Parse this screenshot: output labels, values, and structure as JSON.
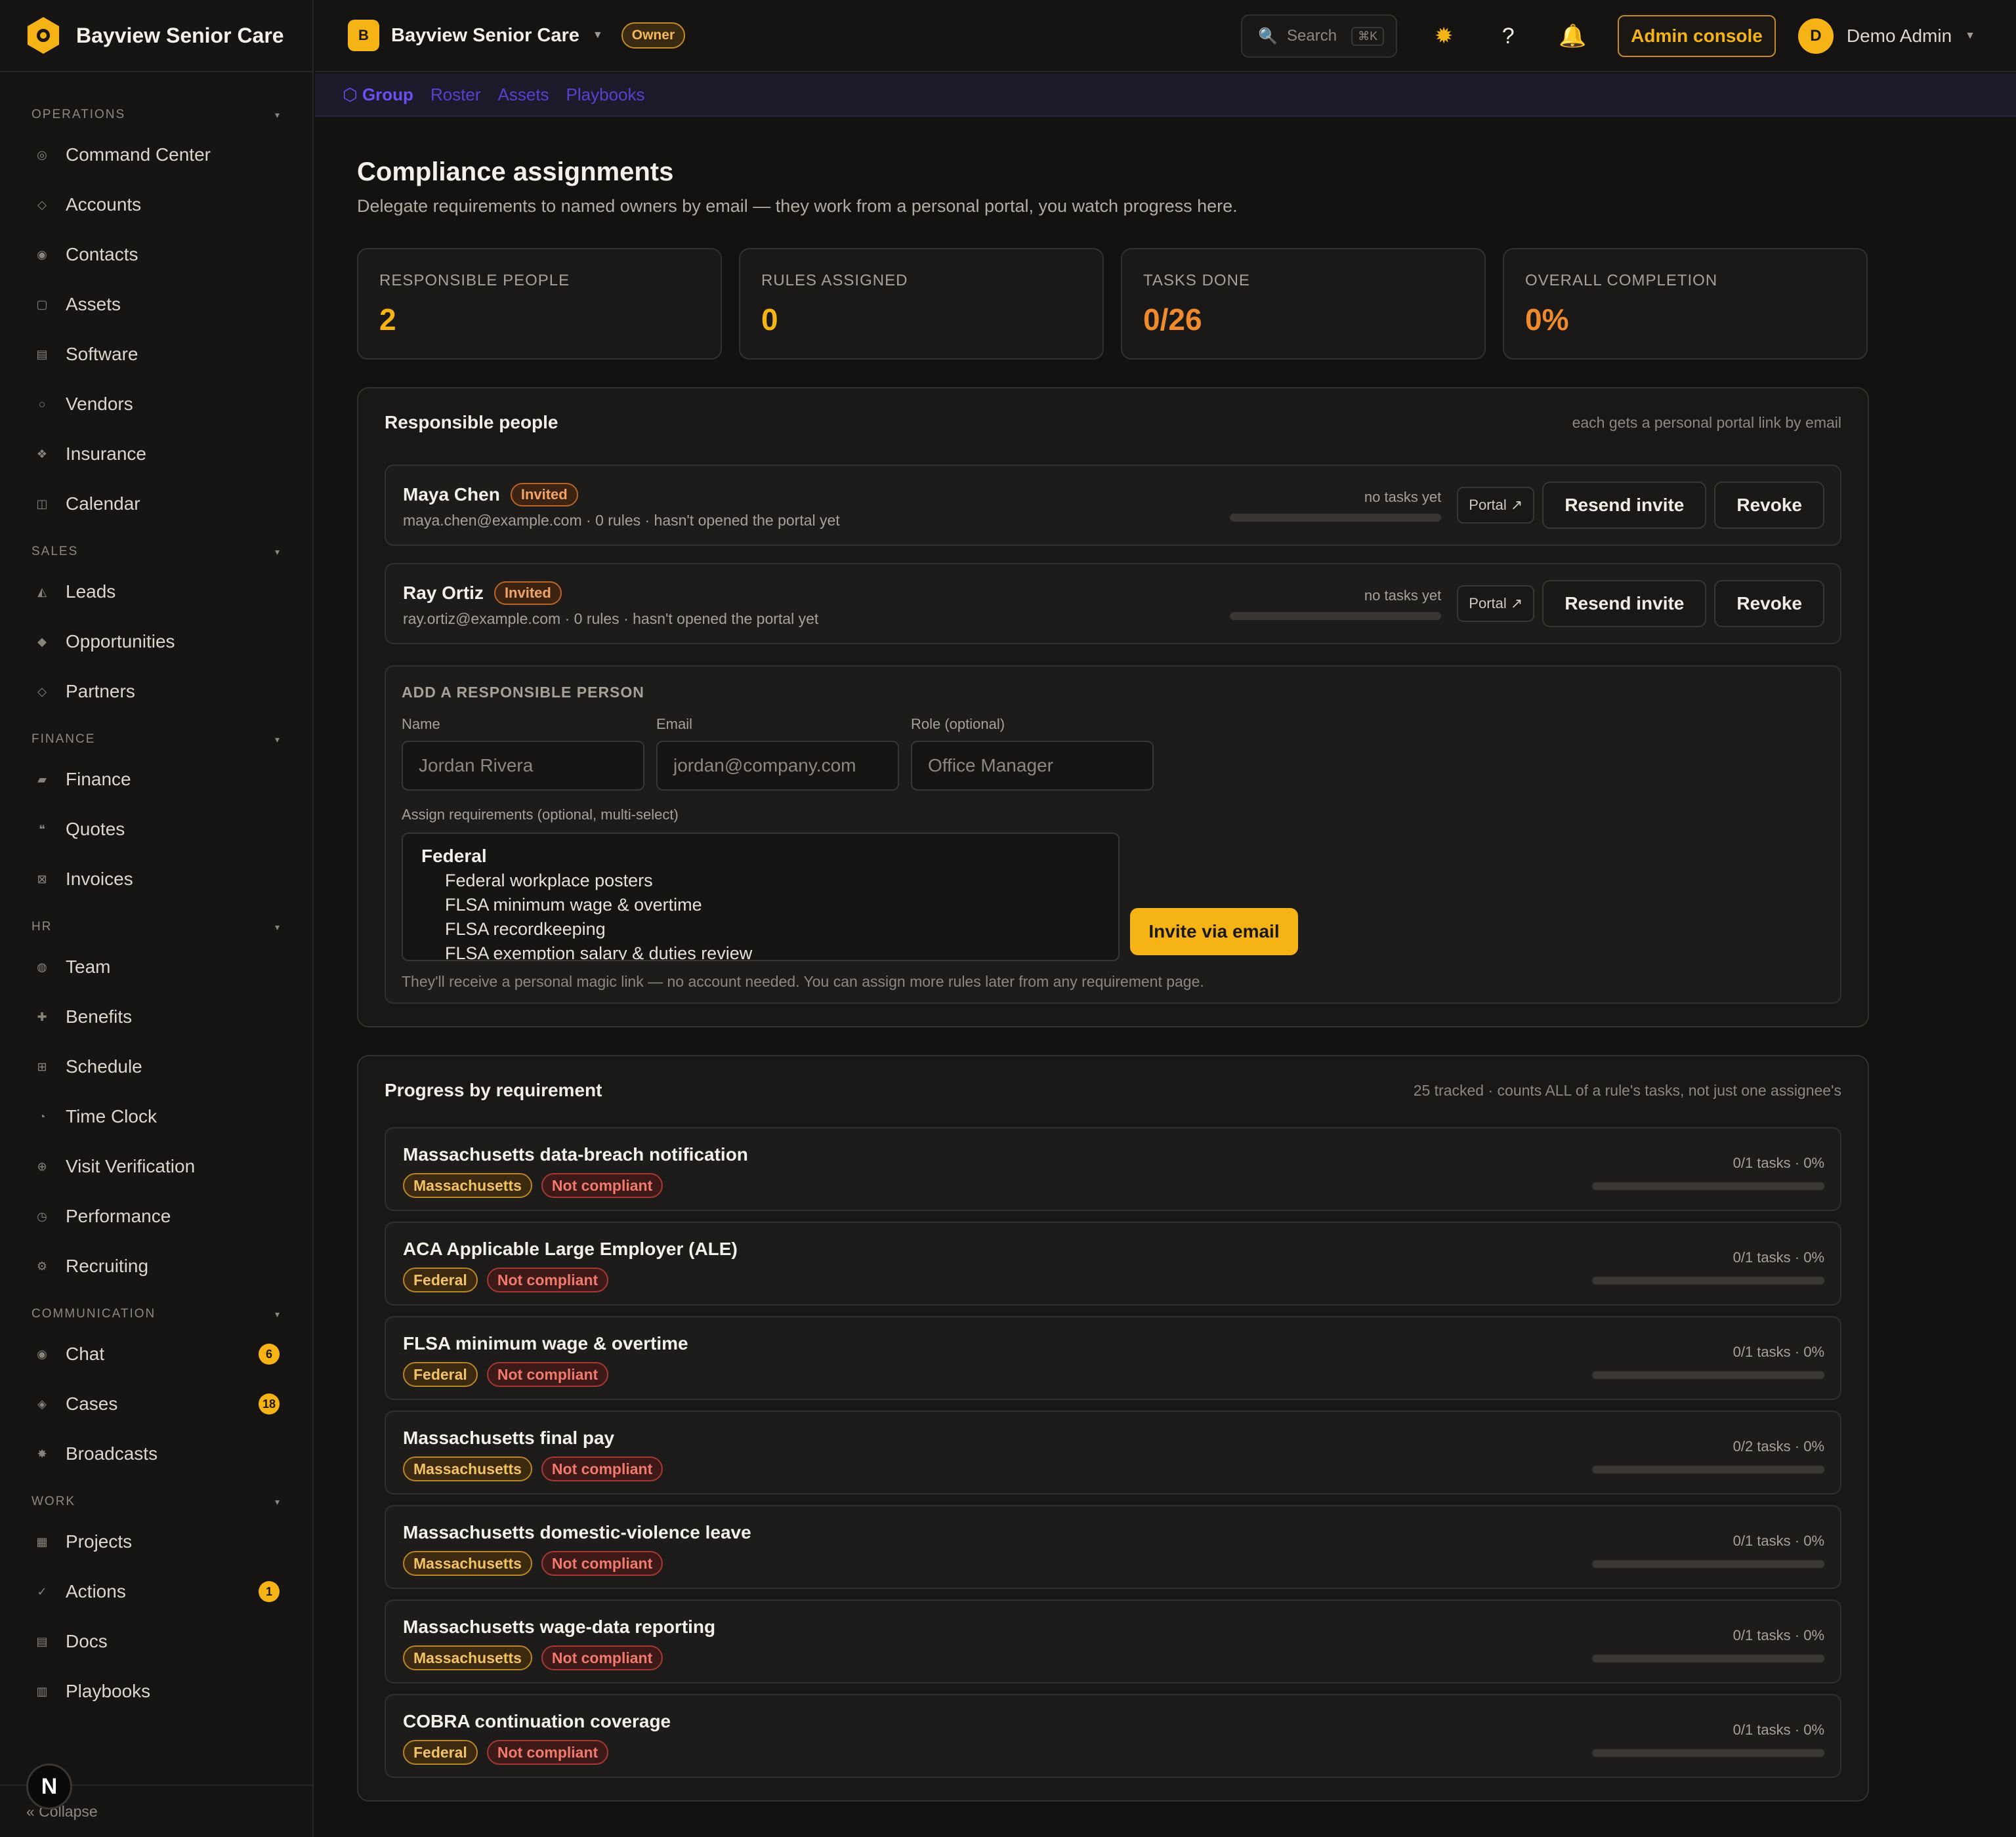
{
  "brand": {
    "name": "Bayview Senior Care"
  },
  "sidebar": {
    "sections": [
      {
        "title": "Operations",
        "items": [
          {
            "label": "Command Center",
            "icon": "◎"
          },
          {
            "label": "Accounts",
            "icon": "◇"
          },
          {
            "label": "Contacts",
            "icon": "◉"
          },
          {
            "label": "Assets",
            "icon": "▢"
          },
          {
            "label": "Software",
            "icon": "▤"
          },
          {
            "label": "Vendors",
            "icon": "○"
          },
          {
            "label": "Insurance",
            "icon": "❖"
          },
          {
            "label": "Calendar",
            "icon": "◫"
          }
        ]
      },
      {
        "title": "Sales",
        "items": [
          {
            "label": "Leads",
            "icon": "◭"
          },
          {
            "label": "Opportunities",
            "icon": "◆"
          },
          {
            "label": "Partners",
            "icon": "◇"
          }
        ]
      },
      {
        "title": "Finance",
        "items": [
          {
            "label": "Finance",
            "icon": "▰"
          },
          {
            "label": "Quotes",
            "icon": "❝"
          },
          {
            "label": "Invoices",
            "icon": "⊠"
          }
        ]
      },
      {
        "title": "HR",
        "items": [
          {
            "label": "Team",
            "icon": "◍"
          },
          {
            "label": "Benefits",
            "icon": "✚"
          },
          {
            "label": "Schedule",
            "icon": "⊞"
          },
          {
            "label": "Time Clock",
            "icon": "◔"
          },
          {
            "label": "Visit Verification",
            "icon": "⊕"
          },
          {
            "label": "Performance",
            "icon": "◷"
          },
          {
            "label": "Recruiting",
            "icon": "⚙"
          }
        ]
      },
      {
        "title": "Communication",
        "items": [
          {
            "label": "Chat",
            "icon": "◉",
            "badge": "6"
          },
          {
            "label": "Cases",
            "icon": "◈",
            "badge": "18"
          },
          {
            "label": "Broadcasts",
            "icon": "✸"
          }
        ]
      },
      {
        "title": "Work",
        "items": [
          {
            "label": "Projects",
            "icon": "▦"
          },
          {
            "label": "Actions",
            "icon": "✓",
            "badge": "1"
          },
          {
            "label": "Docs",
            "icon": "▤"
          },
          {
            "label": "Playbooks",
            "icon": "▥"
          }
        ]
      }
    ],
    "collapse_label": "« Collapse",
    "bubble_letter": "N"
  },
  "topbar": {
    "org_initial": "B",
    "org_name": "Bayview Senior Care",
    "role_badge": "Owner",
    "search_placeholder": "Search",
    "search_shortcut": "⌘K",
    "admin_console": "Admin console",
    "user_initial": "D",
    "user_name": "Demo Admin"
  },
  "subnav": [
    "Group",
    "Roster",
    "Assets",
    "Playbooks"
  ],
  "page": {
    "title": "Compliance assignments",
    "subtitle": "Delegate requirements to named owners by email — they work from a personal portal, you watch progress here."
  },
  "stats": [
    {
      "label": "Responsible people",
      "value": "2",
      "color": "#f5b316"
    },
    {
      "label": "Rules assigned",
      "value": "0",
      "color": "#f5b316"
    },
    {
      "label": "Tasks done",
      "value": "0/26",
      "color": "#ef8b2c"
    },
    {
      "label": "Overall completion",
      "value": "0%",
      "color": "#ef8b2c"
    }
  ],
  "people_card": {
    "title": "Responsible people",
    "note": "each gets a personal portal link by email",
    "people": [
      {
        "name": "Maya Chen",
        "status": "Invited",
        "meta": "maya.chen@example.com · 0 rules · hasn't opened the portal yet",
        "progress_text": "no tasks yet",
        "progress": 0
      },
      {
        "name": "Ray Ortiz",
        "status": "Invited",
        "meta": "ray.ortiz@example.com · 0 rules · hasn't opened the portal yet",
        "progress_text": "no tasks yet",
        "progress": 0
      }
    ],
    "portal_label": "Portal ↗",
    "resend_label": "Resend invite",
    "revoke_label": "Revoke"
  },
  "add_form": {
    "title": "Add a responsible person",
    "name_label": "Name",
    "name_placeholder": "Jordan Rivera",
    "email_label": "Email",
    "email_placeholder": "jordan@company.com",
    "role_label": "Role (optional)",
    "role_placeholder": "Office Manager",
    "assign_label": "Assign requirements (optional, multi-select)",
    "group": "Federal",
    "options": [
      "Federal workplace posters",
      "FLSA minimum wage & overtime",
      "FLSA recordkeeping",
      "FLSA exemption salary & duties review"
    ],
    "invite_label": "Invite via email",
    "note": "They'll receive a personal magic link — no account needed. You can assign more rules later from any requirement page."
  },
  "progress_card": {
    "title": "Progress by requirement",
    "note": "25 tracked · counts ALL of a rule's tasks, not just one assignee's",
    "requirements": [
      {
        "name": "Massachusetts data-breach notification",
        "jurisdiction": "Massachusetts",
        "status": "Not compliant",
        "progress_text": "0/1 tasks · 0%",
        "progress": 0
      },
      {
        "name": "ACA Applicable Large Employer (ALE)",
        "jurisdiction": "Federal",
        "status": "Not compliant",
        "progress_text": "0/1 tasks · 0%",
        "progress": 0
      },
      {
        "name": "FLSA minimum wage & overtime",
        "jurisdiction": "Federal",
        "status": "Not compliant",
        "progress_text": "0/1 tasks · 0%",
        "progress": 0
      },
      {
        "name": "Massachusetts final pay",
        "jurisdiction": "Massachusetts",
        "status": "Not compliant",
        "progress_text": "0/2 tasks · 0%",
        "progress": 0
      },
      {
        "name": "Massachusetts domestic-violence leave",
        "jurisdiction": "Massachusetts",
        "status": "Not compliant",
        "progress_text": "0/1 tasks · 0%",
        "progress": 0
      },
      {
        "name": "Massachusetts wage-data reporting",
        "jurisdiction": "Massachusetts",
        "status": "Not compliant",
        "progress_text": "0/1 tasks · 0%",
        "progress": 0
      },
      {
        "name": "COBRA continuation coverage",
        "jurisdiction": "Federal",
        "status": "Not compliant",
        "progress_text": "0/1 tasks · 0%",
        "progress": 0
      }
    ]
  }
}
